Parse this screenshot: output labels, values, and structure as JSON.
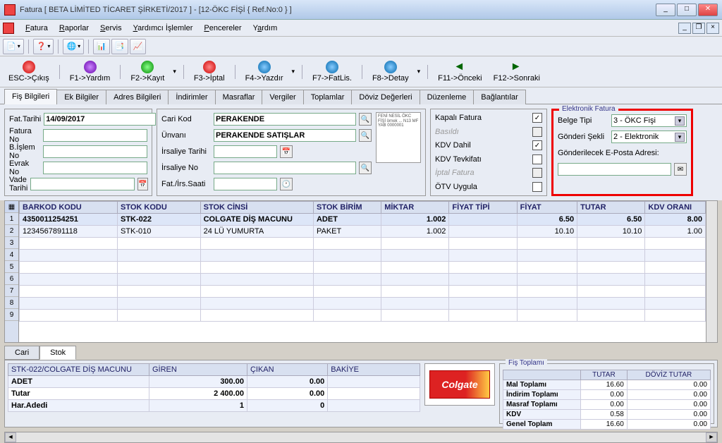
{
  "window": {
    "title": "Fatura [ BETA LİMİTED TİCARET ŞİRKETİ/2017 ]  -  [12-ÖKC FİŞİ { Ref.No:0 } ]"
  },
  "menu": {
    "fatura": "Fatura",
    "raporlar": "Raporlar",
    "servis": "Servis",
    "yardimci": "Yardımcı İşlemler",
    "pencereler": "Pencereler",
    "yardim": "Yardım"
  },
  "fkeys": {
    "esc": "ESC->Çıkış",
    "f1": "F1->Yardım",
    "f2": "F2->Kayıt",
    "f3": "F3->İptal",
    "f4": "F4->Yazdır",
    "f7": "F7->FatLis.",
    "f8": "F8->Detay",
    "f11": "F11->Önceki",
    "f12": "F12->Sonraki"
  },
  "tabs": {
    "fis": "Fiş Bilgileri",
    "ek": "Ek Bilgiler",
    "adres": "Adres Bilgileri",
    "indirim": "İndirimler",
    "masraf": "Masraflar",
    "vergi": "Vergiler",
    "toplam": "Toplamlar",
    "doviz": "Döviz Değerleri",
    "duzenleme": "Düzenleme",
    "baglanti": "Bağlantılar"
  },
  "left": {
    "fattarihi_lbl": "Fat.Tarihi",
    "fattarihi": "14/09/2017",
    "faturano_lbl": "Fatura No",
    "bislem_lbl": "B.İşlem No",
    "evrak_lbl": "Evrak No",
    "vade_lbl": "Vade Tarihi"
  },
  "mid": {
    "carikod_lbl": "Cari Kod",
    "carikod": "PERAKENDE",
    "unvan_lbl": "Ünvanı",
    "unvan": "PERAKENDE SATIŞLAR",
    "irstarih_lbl": "İrsaliye Tarihi",
    "irsno_lbl": "İrsaliye No",
    "fatirs_lbl": "Fat./İrs.Saati"
  },
  "preview": "FENİ NESİL ÖKC FİŞİ örnek\n...\nN13\nMF YAB 0000001",
  "checks": {
    "kapali": "Kapalı Fatura",
    "basildi": "Basıldı",
    "kdvdahil": "KDV Dahil",
    "kdvtevk": "KDV Tevkifatı",
    "iptal": "İptal Fatura",
    "otv": "ÖTV Uygula"
  },
  "efatura": {
    "legend": "Elektronik Fatura",
    "belgetipi_lbl": "Belge Tipi",
    "belgetipi": "3 - ÖKC Fişi",
    "gonderi_lbl": "Gönderi Şekli",
    "gonderi": "2 - Elektronik",
    "eposta_lbl": "Gönderilecek E-Posta Adresi:"
  },
  "grid": {
    "headers": {
      "barkod": "BARKOD KODU",
      "stokkod": "STOK KODU",
      "stokcinsi": "STOK CİNSİ",
      "stokbirim": "STOK BİRİM",
      "miktar": "MİKTAR",
      "fiyattipi": "FİYAT TİPİ",
      "fiyat": "FİYAT",
      "tutar": "TUTAR",
      "kdvorani": "KDV ORANI"
    },
    "rows": [
      {
        "barkod": "4350011254251",
        "stokkod": "STK-022",
        "stokcinsi": "COLGATE DİŞ MACUNU",
        "stokbirim": "ADET",
        "miktar": "1.002",
        "fiyattipi": "",
        "fiyat": "6.50",
        "tutar": "6.50",
        "kdv": "8.00"
      },
      {
        "barkod": "1234567891118",
        "stokkod": "STK-010",
        "stokcinsi": "24 LÜ YUMURTA",
        "stokbirim": "PAKET",
        "miktar": "1.002",
        "fiyattipi": "",
        "fiyat": "10.10",
        "tutar": "10.10",
        "kdv": "1.00"
      }
    ]
  },
  "btabs": {
    "cari": "Cari",
    "stok": "Stok"
  },
  "stock": {
    "title": "STK-022/COLGATE DİŞ MACUNU",
    "hdr_giren": "GİREN",
    "hdr_cikan": "ÇIKAN",
    "hdr_bakiye": "BAKİYE",
    "adet_lbl": "ADET",
    "adet_g": "300.00",
    "adet_c": "0.00",
    "tutar_lbl": "Tutar",
    "tutar_g": "2 400.00",
    "tutar_c": "0.00",
    "har_lbl": "Har.Adedi",
    "har_g": "1",
    "har_c": "0",
    "brand": "Colgate"
  },
  "fistoplami": {
    "legend": "Fiş Toplamı",
    "hdr_tutar": "TUTAR",
    "hdr_doviz": "DÖVİZ TUTAR",
    "mal": "Mal Toplamı",
    "mal_t": "16.60",
    "mal_d": "0.00",
    "ind": "İndirim Toplamı",
    "ind_t": "0.00",
    "ind_d": "0.00",
    "mas": "Masraf Toplamı",
    "mas_t": "0.00",
    "mas_d": "0.00",
    "kdv": "KDV",
    "kdv_t": "0.58",
    "kdv_d": "0.00",
    "gen": "Genel Toplam",
    "gen_t": "16.60",
    "gen_d": "0.00"
  }
}
